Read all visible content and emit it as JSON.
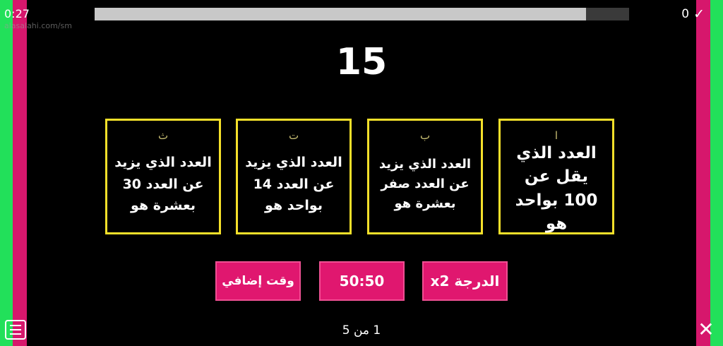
{
  "header": {
    "timer": "0:27",
    "watermark": "alasalahi.com/sm",
    "progress": 0.92,
    "score": "0",
    "check_glyph": "✓"
  },
  "question": {
    "number": "15"
  },
  "answers": [
    {
      "letter": "ا",
      "text": "العدد الذي يقل عن 100 بواحد هو"
    },
    {
      "letter": "ب",
      "text": "العدد الذي يزيد عن العدد صفر بعشرة هو"
    },
    {
      "letter": "ت",
      "text": "العدد الذي يزيد عن العدد 14 بواحد هو"
    },
    {
      "letter": "ث",
      "text": "العدد الذي يزيد عن العدد 30 بعشرة هو"
    }
  ],
  "lifelines": {
    "double": "الدرجة x2",
    "fifty": "50:50",
    "extra_time": "وقت إضافي"
  },
  "footer": {
    "page": "1 من 5",
    "close_glyph": "✕"
  },
  "colors": {
    "answer_border": "#f5e02a",
    "lifeline": "#e0176f",
    "side_green": "#22e05a",
    "side_pink": "#d6176c"
  },
  "icons": [
    "check-icon",
    "menu-icon",
    "close-icon"
  ]
}
